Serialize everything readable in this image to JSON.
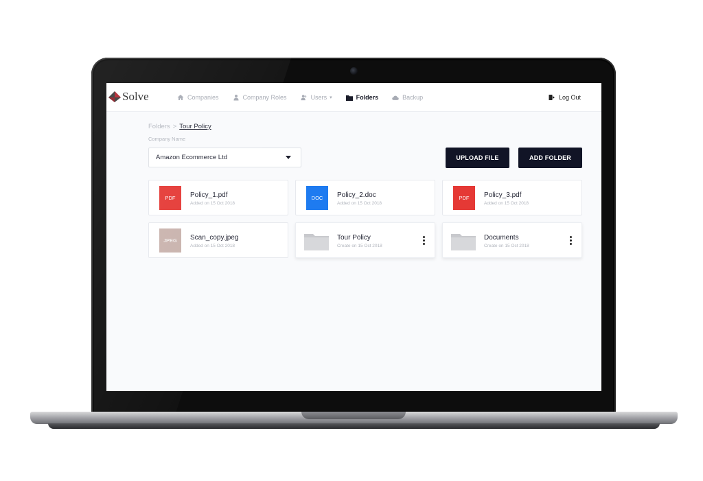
{
  "app": {
    "logo_text": "Solve"
  },
  "nav": {
    "items": [
      {
        "label": "Companies",
        "icon": "home-icon",
        "active": false
      },
      {
        "label": "Company Roles",
        "icon": "user-role-icon",
        "active": false
      },
      {
        "label": "Users",
        "icon": "users-icon",
        "active": false,
        "dropdown": true
      },
      {
        "label": "Folders",
        "icon": "folder-icon",
        "active": true
      },
      {
        "label": "Backup",
        "icon": "cloud-icon",
        "active": false
      }
    ],
    "logout_label": "Log Out"
  },
  "breadcrumb": {
    "parent": "Folders",
    "separator": ">",
    "current": "Tour Policy"
  },
  "company_select": {
    "label": "Company Name",
    "value": "Amazon Ecommerce Ltd"
  },
  "actions": {
    "upload_label": "UPLOAD FILE",
    "add_folder_label": "ADD FOLDER"
  },
  "items": [
    {
      "type": "file",
      "badge": "PDF",
      "badge_color": "#e53935",
      "name": "Policy_1.pdf",
      "meta": "Added on 15 Oct 2018"
    },
    {
      "type": "file",
      "badge": "DOC",
      "badge_color": "#1e7bf0",
      "name": "Policy_2.doc",
      "meta": "Added on 15 Oct 2018"
    },
    {
      "type": "file",
      "badge": "PDF",
      "badge_color": "#e53935",
      "name": "Policy_3.pdf",
      "meta": "Added on 15 Oct 2018"
    },
    {
      "type": "file",
      "badge": "JPEG",
      "badge_color": "#c9b3ad",
      "name": "Scan_copy.jpeg",
      "meta": "Added on 15 Oct 2018"
    },
    {
      "type": "folder",
      "name": "Tour Policy",
      "meta": "Create on 15 Oct 2018"
    },
    {
      "type": "folder",
      "name": "Documents",
      "meta": "Create on 15 Oct 2018"
    }
  ],
  "colors": {
    "primary_button": "#111426",
    "pdf": "#e53935",
    "doc": "#1e7bf0",
    "jpeg": "#c9b3ad"
  }
}
